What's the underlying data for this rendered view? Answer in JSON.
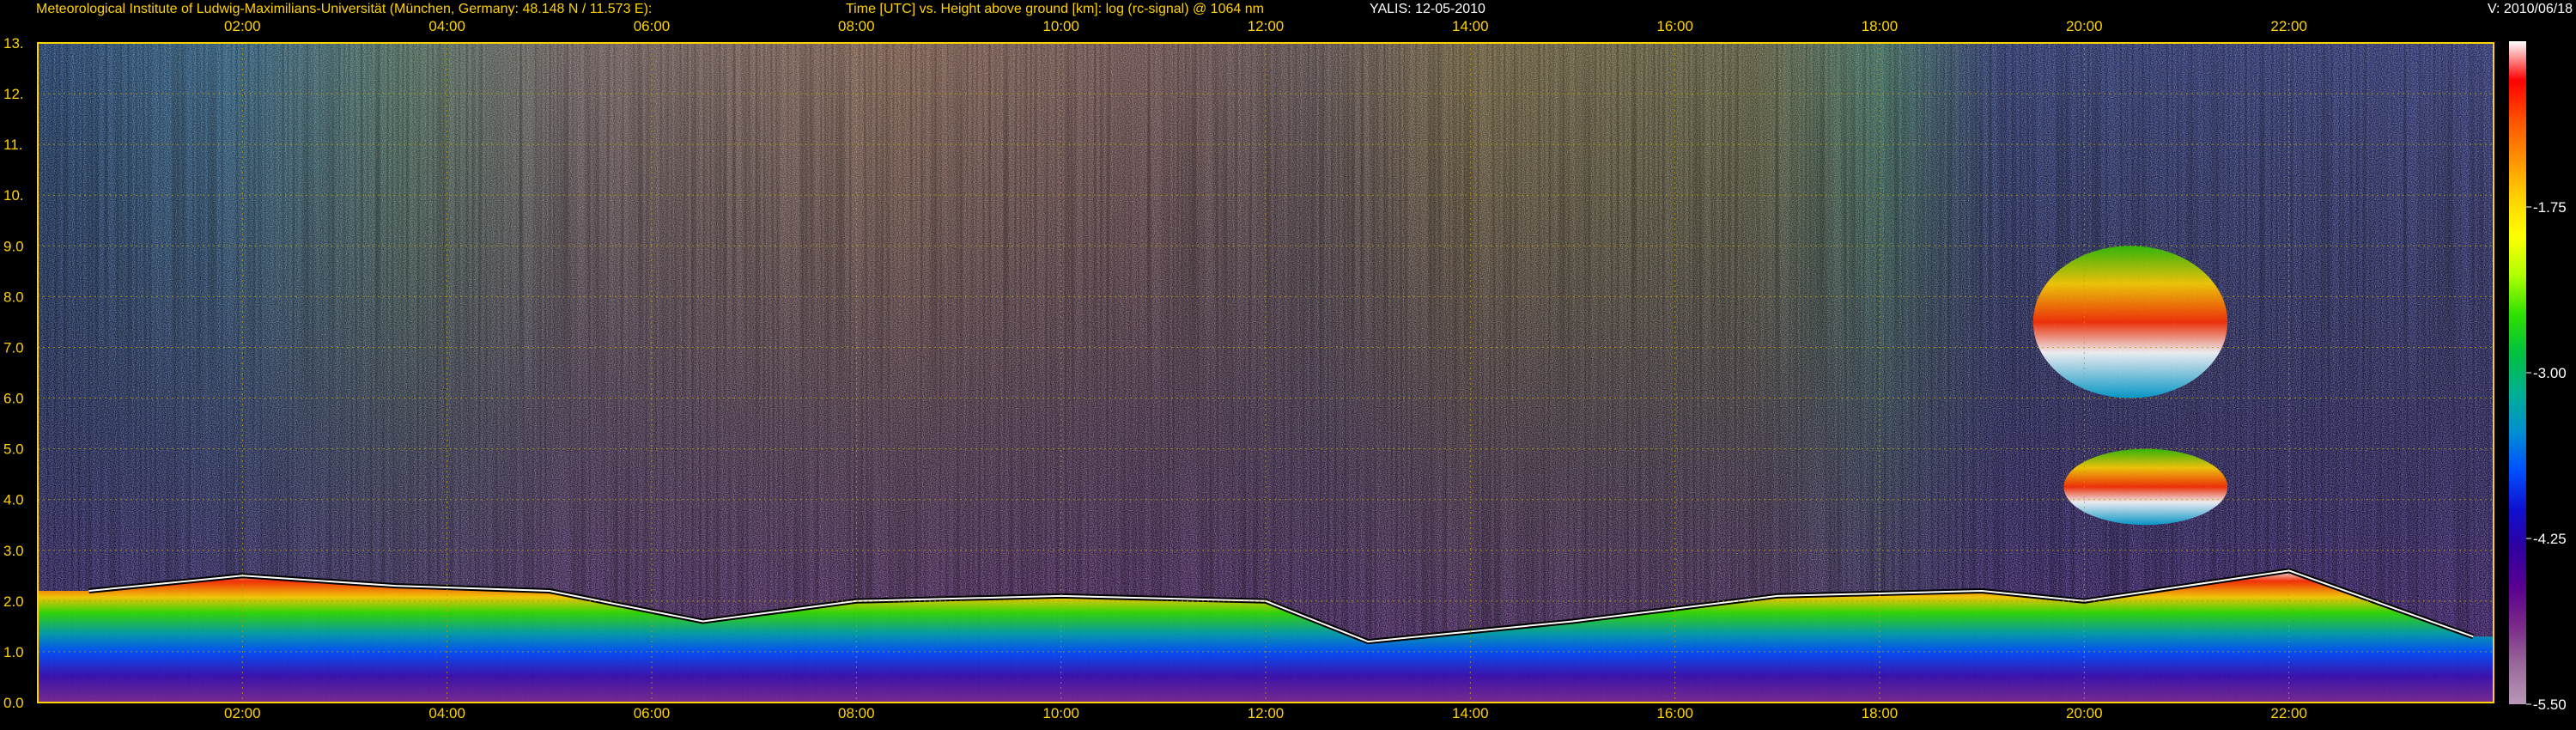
{
  "header": {
    "institute": "Meteorological Institute of Ludwig-Maximilians-Universität (München, Germany: 48.148 N / 11.573 E):",
    "title": "Time [UTC] vs. Height above ground [km]: log (rc-signal) @ 1064 nm",
    "system": "YALIS: 12-05-2010",
    "version": "V: 2010/06/18"
  },
  "chart_data": {
    "type": "heatmap",
    "title": "Time [UTC] vs. Height above ground [km]: log (rc-signal) @ 1064 nm",
    "x_ticks": [
      "02:00",
      "04:00",
      "06:00",
      "08:00",
      "10:00",
      "12:00",
      "14:00",
      "16:00",
      "18:00",
      "20:00",
      "22:00"
    ],
    "x_tick_hours": [
      2,
      4,
      6,
      8,
      10,
      12,
      14,
      16,
      18,
      20,
      22
    ],
    "xlim_hours": [
      0.0,
      24.0
    ],
    "y_ticks": [
      "0.0",
      "1.0",
      "2.0",
      "3.0",
      "4.0",
      "5.0",
      "6.0",
      "7.0",
      "8.0",
      "9.0",
      "10.",
      "11.",
      "12.",
      "13."
    ],
    "ylim_km": [
      0.0,
      13.0
    ],
    "colorbar": {
      "labels": [
        "-1.75",
        "-3.00",
        "-4.25",
        "-5.50"
      ],
      "values": [
        -1.75,
        -3.0,
        -4.25,
        -5.5
      ],
      "range": [
        -5.5,
        -0.5
      ],
      "colors_high_to_low": [
        "#ffffff",
        "#ff0000",
        "#ff5000",
        "#ff9000",
        "#ffd000",
        "#ffff00",
        "#b0ff00",
        "#30e000",
        "#00c040",
        "#00b090",
        "#0090d0",
        "#0050ff",
        "#1010d0",
        "#3000a0",
        "#5a0090",
        "#7a2a88",
        "#9a6a9a",
        "#b898b8"
      ]
    },
    "grid": true,
    "features": {
      "boundary_layer_top_km": [
        [
          0.5,
          2.2
        ],
        [
          2.0,
          2.5
        ],
        [
          3.5,
          2.3
        ],
        [
          5.0,
          2.2
        ],
        [
          6.5,
          1.6
        ],
        [
          8.0,
          2.0
        ],
        [
          10.0,
          2.1
        ],
        [
          12.0,
          2.0
        ],
        [
          13.0,
          1.2
        ],
        [
          15.0,
          1.6
        ],
        [
          17.0,
          2.1
        ],
        [
          19.0,
          2.2
        ],
        [
          20.0,
          2.0
        ],
        [
          22.0,
          2.6
        ],
        [
          23.8,
          1.3
        ]
      ],
      "cirrus_patches": [
        {
          "t0": 19.5,
          "t1": 21.4,
          "z0": 6.0,
          "z1": 9.0
        },
        {
          "t0": 19.8,
          "t1": 21.4,
          "z0": 3.5,
          "z1": 5.0
        }
      ]
    }
  }
}
